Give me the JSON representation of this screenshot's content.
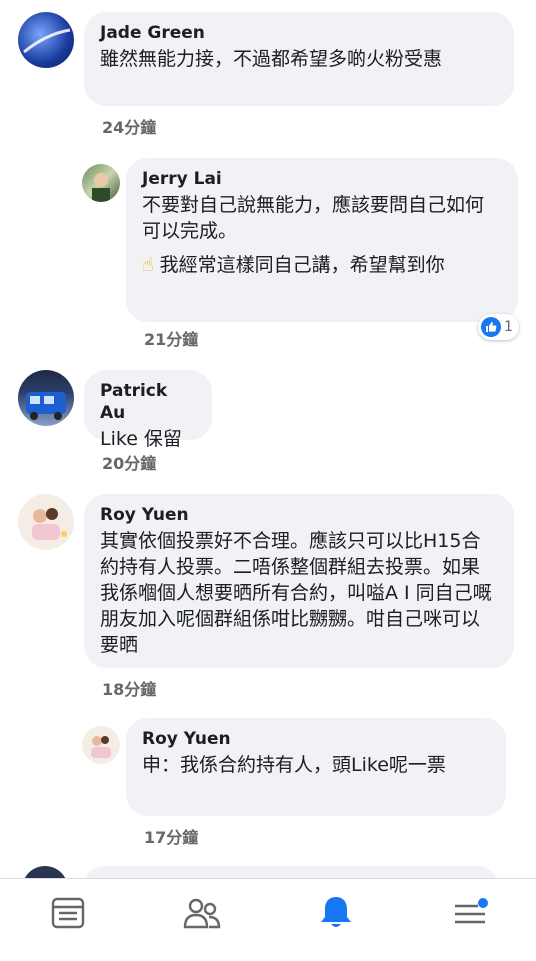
{
  "comments": [
    {
      "name": "Jade Green",
      "text": "雖然無能力接，不過都希望多啲火粉受惠",
      "time": "24分鐘"
    },
    {
      "name": "Jerry Lai",
      "text": "不要對自己說無能力，應該要問自己如何可以完成。",
      "text2": "我經常這樣同自己講，希望幫到你",
      "emoji": "☝",
      "time": "21分鐘",
      "reaction_count": "1"
    },
    {
      "name": "Patrick Au",
      "text": "Like 保留",
      "time": "20分鐘"
    },
    {
      "name": "Roy Yuen",
      "text": "其實依個投票好不合理。應該只可以比H15合約持有人投票。二唔係整個群組去投票。如果我係嗰個人想要晒所有合約，叫嗌A I 同自己嘅朋友加入呢個群組係咁比嬲嬲。咁自己咪可以要晒",
      "time": "18分鐘"
    },
    {
      "name": "Roy Yuen",
      "text": "申：我係合約持有人，頭Like呢一票",
      "time": "17分鐘"
    }
  ],
  "tabs": [
    {
      "icon": "news-feed-icon"
    },
    {
      "icon": "friends-icon"
    },
    {
      "icon": "notifications-bell-icon",
      "active": true
    },
    {
      "icon": "menu-icon",
      "badge": true
    }
  ],
  "colors": {
    "accent": "#1877f2",
    "bubble": "#f0f2f5",
    "meta": "#65676b"
  }
}
